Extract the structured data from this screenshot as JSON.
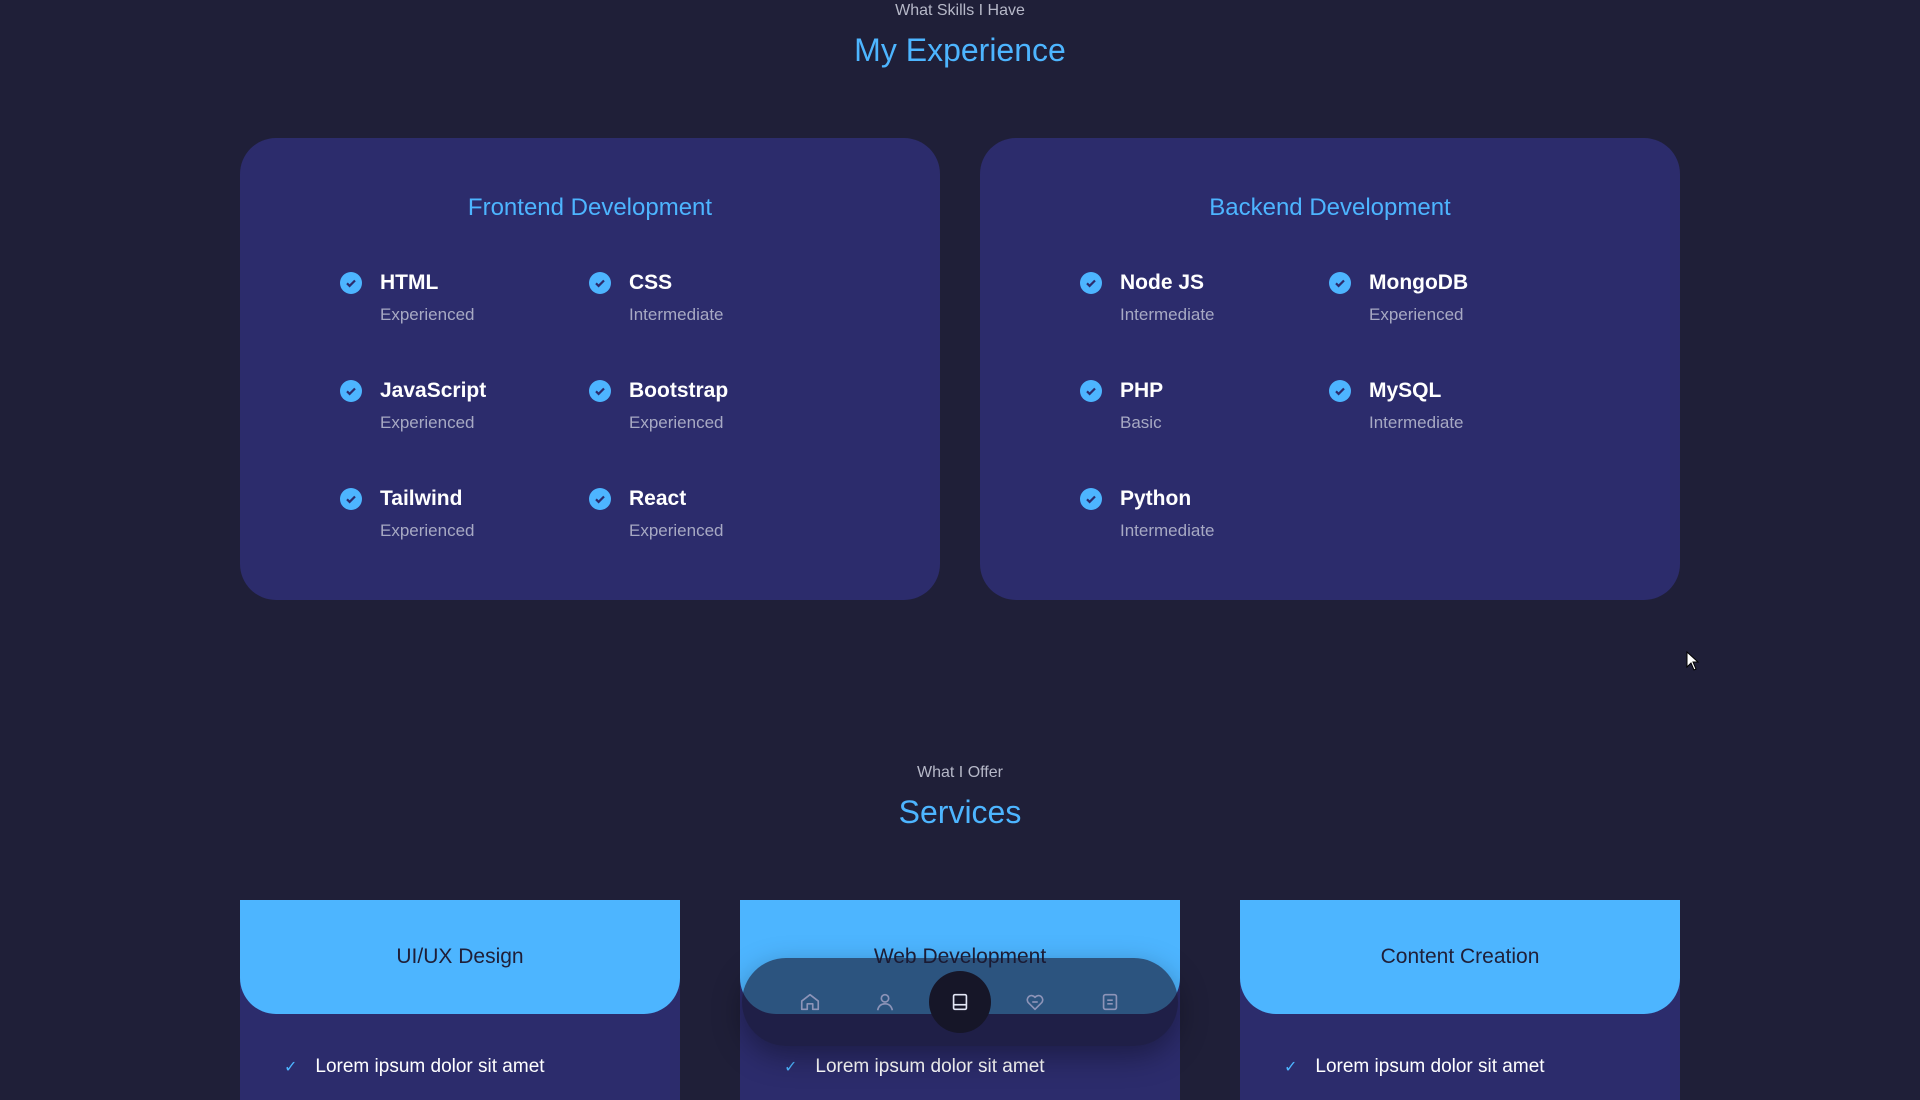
{
  "experience": {
    "kicker": "What Skills I Have",
    "title": "My Experience",
    "frontend": {
      "title": "Frontend Development",
      "skills": [
        {
          "name": "HTML",
          "level": "Experienced"
        },
        {
          "name": "CSS",
          "level": "Intermediate"
        },
        {
          "name": "JavaScript",
          "level": "Experienced"
        },
        {
          "name": "Bootstrap",
          "level": "Experienced"
        },
        {
          "name": "Tailwind",
          "level": "Experienced"
        },
        {
          "name": "React",
          "level": "Experienced"
        }
      ]
    },
    "backend": {
      "title": "Backend Development",
      "skills": [
        {
          "name": "Node JS",
          "level": "Intermediate"
        },
        {
          "name": "MongoDB",
          "level": "Experienced"
        },
        {
          "name": "PHP",
          "level": "Basic"
        },
        {
          "name": "MySQL",
          "level": "Intermediate"
        },
        {
          "name": "Python",
          "level": "Intermediate"
        }
      ]
    }
  },
  "services": {
    "kicker": "What I Offer",
    "title": "Services",
    "cards": [
      {
        "title": "UI/UX Design",
        "item": "Lorem ipsum dolor sit amet"
      },
      {
        "title": "Web Development",
        "item": "Lorem ipsum dolor sit amet"
      },
      {
        "title": "Content Creation",
        "item": "Lorem ipsum dolor sit amet"
      }
    ]
  },
  "nav": {
    "items": [
      {
        "icon": "home-icon"
      },
      {
        "icon": "user-icon"
      },
      {
        "icon": "book-icon",
        "active": true
      },
      {
        "icon": "services-icon"
      },
      {
        "icon": "message-icon"
      }
    ]
  },
  "colors": {
    "background": "#1f1f38",
    "card": "#2c2c6c",
    "accent": "#4db5ff",
    "muted_text": "#a7a9c3"
  }
}
